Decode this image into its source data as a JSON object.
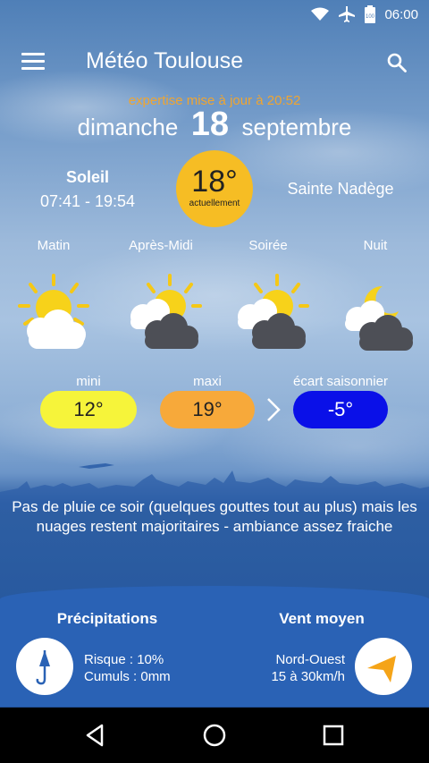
{
  "statusbar": {
    "time": "06:00",
    "battery": "100"
  },
  "appbar": {
    "title": "Météo Toulouse"
  },
  "updated": "expertise mise à jour à 20:52",
  "date": {
    "day_name": "dimanche",
    "day_num": "18",
    "month": "septembre"
  },
  "sun": {
    "label": "Soleil",
    "hours": "07:41 - 19:54"
  },
  "current": {
    "temp": "18°",
    "label": "actuellement"
  },
  "saint": "Sainte Nadège",
  "periods": [
    {
      "label": "Matin",
      "icon": "sun-cloud-icon"
    },
    {
      "label": "Après-Midi",
      "icon": "sun-dark-cloud-icon"
    },
    {
      "label": "Soirée",
      "icon": "sun-dark-cloud-icon"
    },
    {
      "label": "Nuit",
      "icon": "moon-dark-cloud-icon"
    }
  ],
  "temps": {
    "mini_label": "mini",
    "mini": "12°",
    "maxi_label": "maxi",
    "maxi": "19°",
    "ecart_label": "écart saisonnier",
    "ecart": "-5°"
  },
  "summary": "Pas de pluie ce soir (quelques gouttes tout au plus) mais les nuages restent majoritaires - ambiance assez fraiche",
  "precip": {
    "title": "Précipitations",
    "risk": "Risque : 10%",
    "cumul": "Cumuls : 0mm"
  },
  "wind": {
    "title": "Vent moyen",
    "direction": "Nord-Ouest",
    "speed": "15 à 30km/h"
  },
  "colors": {
    "accent_orange": "#f0a530",
    "mini": "#f6f43a",
    "maxi": "#f7a93a",
    "ecart": "#0a10e8",
    "current": "#f6bd24"
  }
}
